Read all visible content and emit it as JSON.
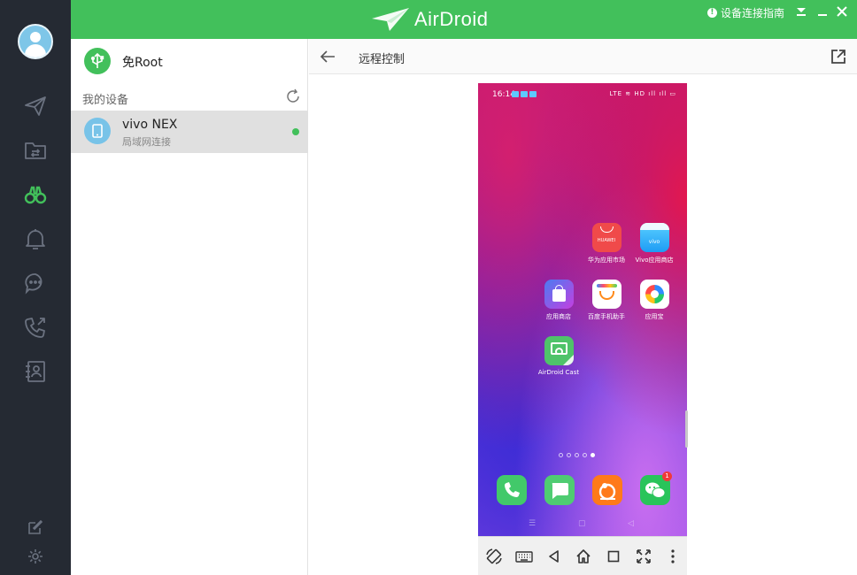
{
  "app": {
    "logo_text": "AirDroid",
    "guide_label": "设备连接指南",
    "brand_color": "#42c05b",
    "sidebar_color": "#252a33"
  },
  "sidebar": {
    "items": [
      {
        "name": "send-icon",
        "active": false
      },
      {
        "name": "file-transfer-icon",
        "active": false
      },
      {
        "name": "binoculars-icon",
        "active": true
      },
      {
        "name": "bell-icon",
        "active": false
      },
      {
        "name": "chat-icon",
        "active": false
      },
      {
        "name": "call-icon",
        "active": false
      },
      {
        "name": "contacts-icon",
        "active": false
      }
    ]
  },
  "panel": {
    "root_label": "免Root",
    "section_label": "我的设备",
    "device": {
      "name": "vivo NEX",
      "connection": "局域网连接",
      "online": true
    }
  },
  "main": {
    "title": "远程控制"
  },
  "phone": {
    "time": "16:14",
    "status_right": "LTE ≋ HD ıll ıll ▭",
    "apps": [
      {
        "label": "华为应用市场",
        "icon": "huawei-appgallery-icon",
        "tile_text": "HUAWEI"
      },
      {
        "label": "Vivo应用商店",
        "icon": "vivo-appstore-icon",
        "tile_text": "vivo"
      },
      {
        "label": "应用商店",
        "icon": "app-store-bag-icon"
      },
      {
        "label": "百度手机助手",
        "icon": "baidu-assistant-icon"
      },
      {
        "label": "应用宝",
        "icon": "yingyongbao-icon"
      },
      {
        "label": "AirDroid Cast",
        "icon": "airdroid-cast-icon"
      }
    ],
    "dock": [
      {
        "icon": "phone-app-icon"
      },
      {
        "icon": "messages-app-icon"
      },
      {
        "icon": "uc-browser-icon"
      },
      {
        "icon": "wechat-icon",
        "badge": "1"
      }
    ],
    "page_dots": 5,
    "active_dot": 4
  }
}
